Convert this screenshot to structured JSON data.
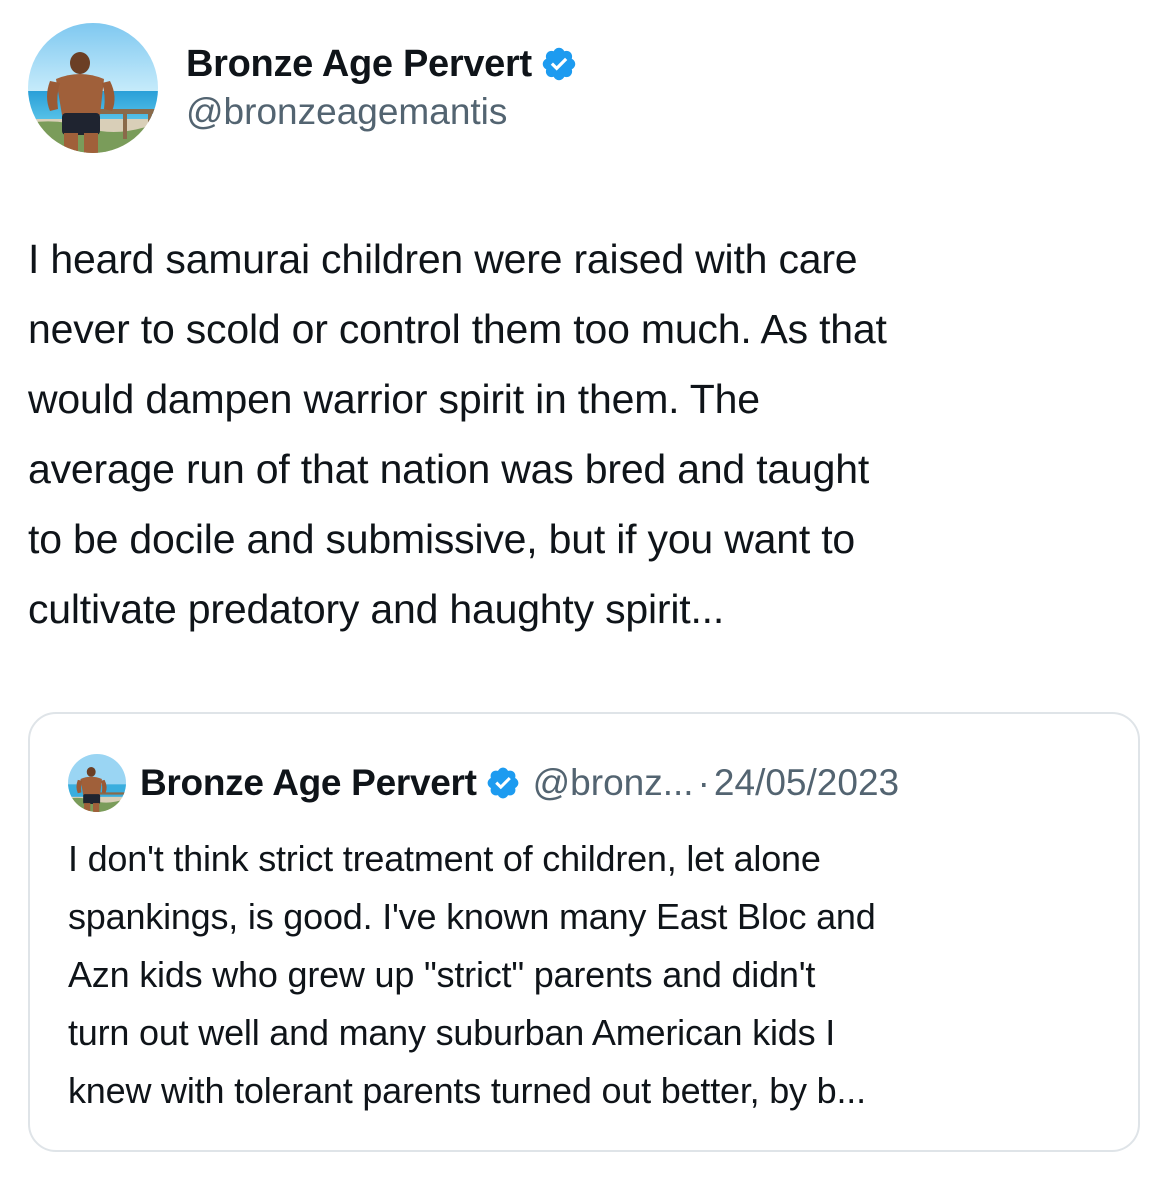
{
  "tweet": {
    "author": {
      "display_name": "Bronze Age Pervert",
      "handle": "@bronzeagemantis",
      "verified_icon": "verified-badge-icon",
      "avatar": "profile-photo-beach"
    },
    "text": "I heard samurai children were raised with care\nnever to scold or control them too much. As that\nwould dampen warrior spirit in them. The\naverage run of that nation was bred and taught\nto be docile and submissive, but if you want to\ncultivate predatory and haughty spirit..."
  },
  "quoted_tweet": {
    "author": {
      "display_name": "Bronze Age Pervert",
      "handle": "@bronz...",
      "verified_icon": "verified-badge-icon"
    },
    "separator": "·",
    "date": "24/05/2023",
    "text": "I don't think strict treatment of children, let alone\nspankings, is good. I've known many East Bloc and\nAzn kids who grew up \"strict\" parents and didn't\nturn out well and many suburban American kids I\nknew with tolerant parents turned out better, by b..."
  },
  "colors": {
    "text_primary": "#0f1419",
    "text_secondary": "#536471",
    "verified_blue": "#1d9bf0",
    "card_border": "#dfe4e8"
  }
}
